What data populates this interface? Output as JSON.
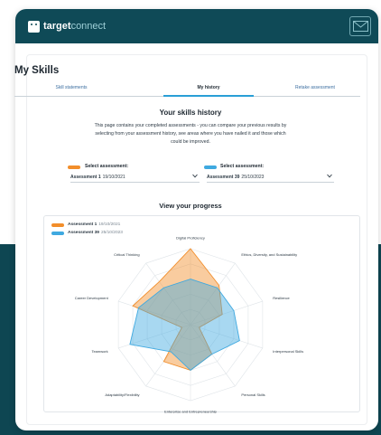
{
  "colors": {
    "brand_dark": "#0f4a57",
    "assessment_1": "#f28e2b",
    "assessment_39": "#3fa9e0",
    "tab_active": "#2a9fd6"
  },
  "header": {
    "logo_bold": "target",
    "logo_light": "connect",
    "mail_icon": "mail-icon"
  },
  "page": {
    "title": "My Skills"
  },
  "tabs": [
    {
      "label": "Skill statements",
      "active": false
    },
    {
      "label": "My history",
      "active": true
    },
    {
      "label": "Retake assessment",
      "active": false
    }
  ],
  "history": {
    "title": "Your skills history",
    "intro": "This page contains your completed assessments - you can compare your previous results by selecting from your assessment history, see areas where you have nailed it and those which could be improved."
  },
  "selectors": [
    {
      "label": "Select assessment:",
      "value_bold": "Assessment 1",
      "value_date": "19/10/2021"
    },
    {
      "label": "Select assessment:",
      "value_bold": "Assessment 39",
      "value_date": "25/10/2023"
    }
  ],
  "progress": {
    "title": "View your progress",
    "legend": [
      {
        "name": "Assessment 1",
        "date": "19/10/2021"
      },
      {
        "name": "Assessment 39",
        "date": "25/10/2023"
      }
    ]
  },
  "chart_data": {
    "type": "radar",
    "categories": [
      "Digital Proficiency",
      "Ethics, Diversity, and Sustainability",
      "Resilience",
      "Interpersonal Skills",
      "Personal Skills",
      "Enterprise and Entrepreneurship",
      "Adaptability/Flexibility",
      "Teamwork",
      "Career Development",
      "Critical Thinking"
    ],
    "rmax": 5,
    "series": [
      {
        "name": "Assessment 1",
        "values": [
          5,
          3.2,
          2.2,
          0.6,
          2.4,
          3,
          3,
          0.6,
          4,
          3.5
        ]
      },
      {
        "name": "Assessment 39",
        "values": [
          3,
          3,
          3,
          3.4,
          2.4,
          3,
          2.2,
          4.2,
          3.6,
          3
        ]
      }
    ]
  }
}
